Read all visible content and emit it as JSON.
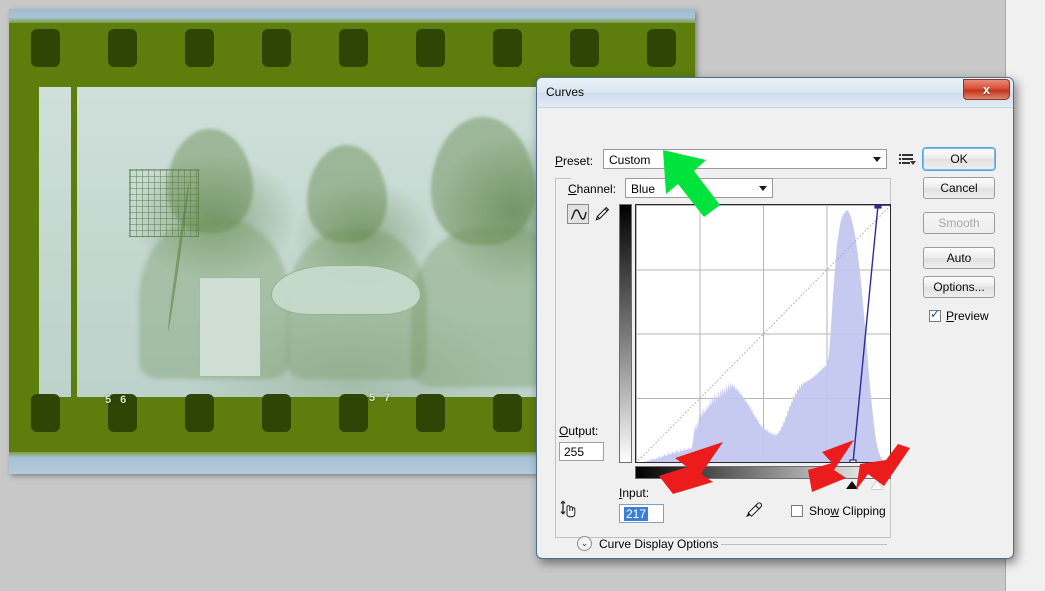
{
  "dialog": {
    "title": "Curves",
    "close_label": "x",
    "preset": {
      "label": "Preset:",
      "value": "Custom"
    },
    "channel": {
      "label": "Channel:",
      "value": "Blue"
    },
    "output": {
      "label": "Output:",
      "value": "255"
    },
    "input": {
      "label": "Input:",
      "value": "217"
    },
    "show_clipping": {
      "label": "Show Clipping",
      "checked": false
    },
    "curve_display_options": "Curve Display Options",
    "buttons": {
      "ok": "OK",
      "cancel": "Cancel",
      "smooth": "Smooth",
      "auto": "Auto",
      "options": "Options..."
    },
    "preview": {
      "label": "Preview",
      "checked": true
    },
    "icons": {
      "curve_tool": "curve-pencil-icon",
      "pencil_tool": "pencil-icon",
      "preset_menu": "preset-menu-icon",
      "on_image_adjust": "on-image-adjustment-hand-icon",
      "eyedropper": "eyedropper-icon",
      "disclosure": "chevron-double-down-icon"
    }
  },
  "annotations": {
    "green_arrow": "green-arrow-pointing-to-channel-dropdown",
    "red_arrow_left": "red-arrow-pointing-to-black-point-slider",
    "red_arrow_right": "red-arrow-pointing-to-white-point-slider",
    "green_color": "#00e23c",
    "red_color": "#ec1c1c"
  },
  "image": {
    "film_frame_numbers": [
      "5 6",
      "5 7"
    ],
    "description": "scanned colour film negative strip of three children"
  },
  "chart_data": {
    "type": "line",
    "title": "Blue channel curve",
    "xlabel": "Input",
    "ylabel": "Output",
    "xlim": [
      0,
      255
    ],
    "ylim": [
      0,
      255
    ],
    "grid": true,
    "legend": "none",
    "series": [
      {
        "name": "blue-curve",
        "points": [
          [
            0,
            0
          ],
          [
            217,
            0
          ],
          [
            242,
            255
          ],
          [
            255,
            255
          ]
        ],
        "color": "#2b2b9e",
        "control_points": [
          [
            217,
            0
          ],
          [
            242,
            255
          ]
        ]
      },
      {
        "name": "baseline-diagonal",
        "points": [
          [
            0,
            0
          ],
          [
            255,
            255
          ]
        ],
        "color": "#a0a0a0"
      }
    ],
    "histogram": {
      "name": "blue-channel-histogram",
      "color": "#c3c6ef",
      "bins": [
        0,
        0,
        0,
        0,
        1,
        2,
        1,
        3,
        2,
        5,
        3,
        8,
        5,
        9,
        6,
        12,
        8,
        15,
        10,
        14,
        9,
        18,
        12,
        22,
        14,
        20,
        16,
        25,
        18,
        30,
        20,
        26,
        22,
        35,
        24,
        31,
        26,
        38,
        28,
        34,
        30,
        42,
        33,
        38,
        30,
        45,
        34,
        40,
        36,
        48,
        38,
        44,
        40,
        50,
        42,
        46,
        44,
        52,
        70,
        95,
        120,
        100,
        130,
        110,
        145,
        125,
        160,
        140,
        175,
        150,
        168,
        158,
        180,
        165,
        190,
        172,
        200,
        178,
        210,
        185,
        220,
        190,
        215,
        195,
        225,
        200,
        232,
        205,
        240,
        210,
        235,
        215,
        245,
        220,
        250,
        226,
        255,
        230,
        248,
        235,
        242,
        228,
        236,
        222,
        230,
        215,
        222,
        208,
        214,
        200,
        205,
        190,
        196,
        182,
        188,
        172,
        178,
        162,
        168,
        150,
        156,
        140,
        148,
        130,
        138,
        120,
        126,
        112,
        118,
        104,
        112,
        100,
        108,
        96,
        104,
        92,
        100,
        88,
        96,
        86,
        94,
        84,
        92,
        86,
        96,
        92,
        104,
        100,
        116,
        112,
        130,
        126,
        148,
        142,
        166,
        158,
        182,
        175,
        196,
        188,
        210,
        200,
        222,
        212,
        234,
        224,
        244,
        232,
        250,
        240,
        254,
        246,
        256,
        250,
        258,
        255,
        262,
        258,
        266,
        262,
        270,
        268,
        276,
        272,
        282,
        278,
        288,
        284,
        294,
        290,
        300,
        296,
        306,
        302,
        312,
        320,
        340,
        380,
        420,
        470,
        520,
        560,
        600,
        640,
        680,
        700,
        720,
        740,
        755,
        765,
        772,
        778,
        782,
        786,
        790,
        788,
        784,
        778,
        770,
        760,
        748,
        734,
        718,
        700,
        680,
        658,
        634,
        608,
        580,
        550,
        518,
        484,
        448,
        412,
        374,
        336,
        298,
        262,
        228,
        196,
        166,
        138,
        112,
        90,
        70,
        54,
        40,
        30,
        22,
        16,
        11,
        8,
        5,
        3,
        2,
        1,
        1,
        0,
        0,
        0
      ]
    }
  }
}
